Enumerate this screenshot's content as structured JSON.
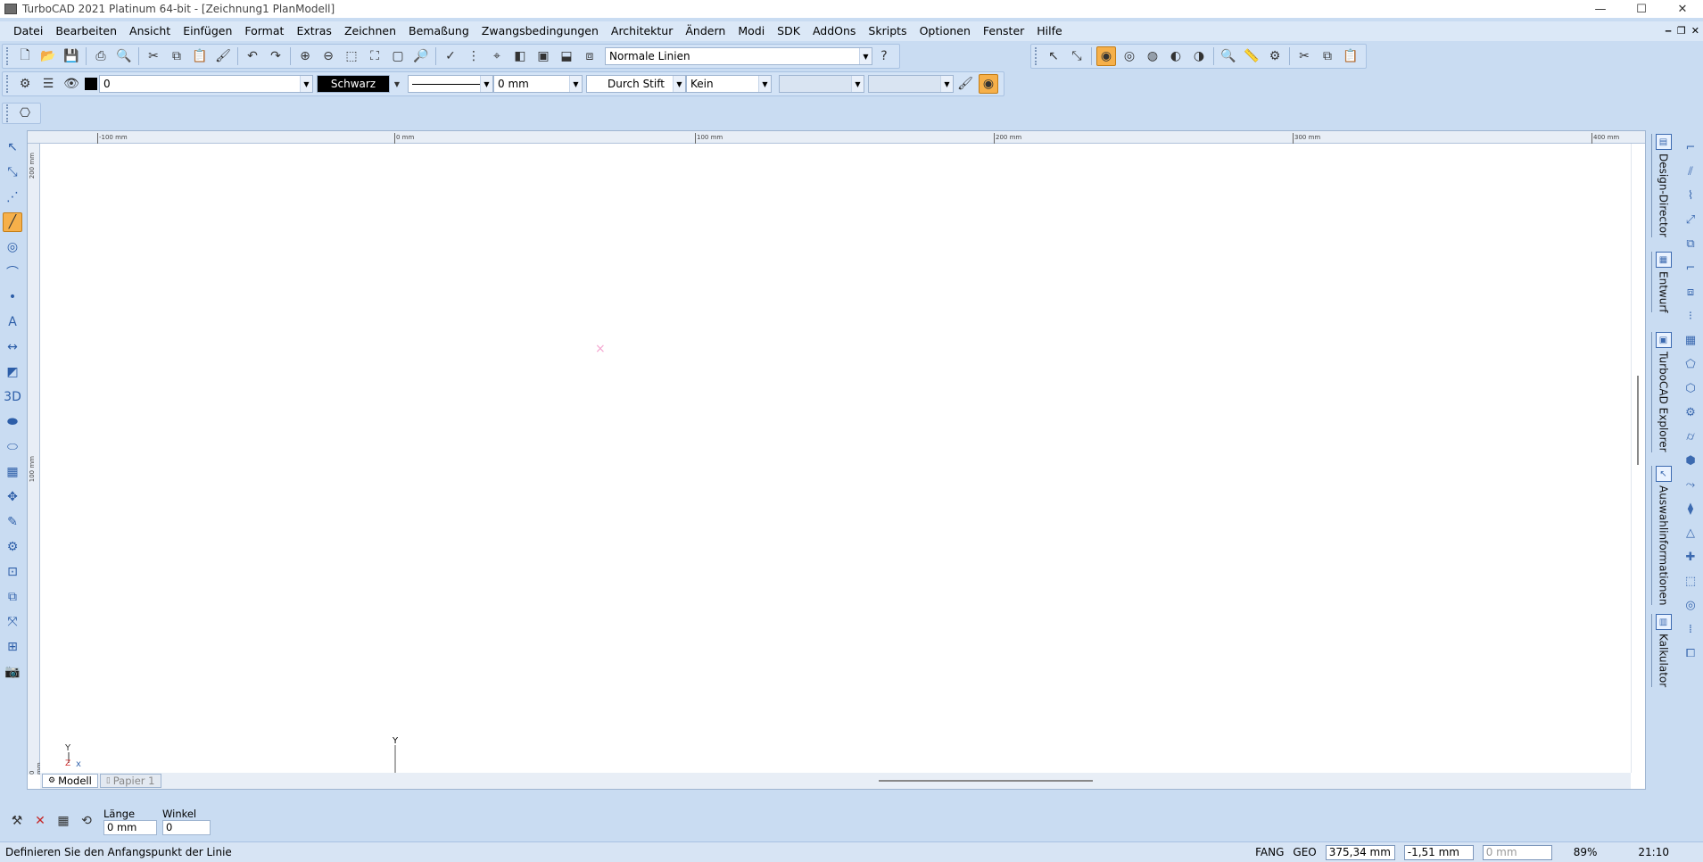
{
  "window": {
    "title": "TurboCAD 2021 Platinum 64-bit - [Zeichnung1 PlanModell]",
    "minimize": "—",
    "maximize": "☐",
    "close": "✕"
  },
  "menu": [
    "Datei",
    "Bearbeiten",
    "Ansicht",
    "Einfügen",
    "Format",
    "Extras",
    "Zeichnen",
    "Bemaßung",
    "Zwangsbedingungen",
    "Architektur",
    "Ändern",
    "Modi",
    "SDK",
    "AddOns",
    "Skripts",
    "Optionen",
    "Fenster",
    "Hilfe"
  ],
  "toolbar": {
    "line_style_combo": "Normale Linien"
  },
  "property_bar": {
    "layer": "0",
    "color": "Schwarz",
    "line_width": "0 mm",
    "pen": "Durch Stift",
    "fill": "Kein"
  },
  "rulers": {
    "horizontal": [
      "-100 mm",
      "0 mm",
      "100 mm",
      "200 mm",
      "300 mm",
      "400 mm"
    ],
    "vertical": [
      "200 mm",
      "100 mm",
      "0 mm"
    ]
  },
  "canvas": {
    "axis_x_label": "X",
    "axis_y_label": "Y"
  },
  "tabs": [
    "Modell",
    "Papier 1"
  ],
  "palettes": [
    "Design-Director",
    "Entwurf",
    "TurboCAD Explorer",
    "Auswahlinformationen",
    "Kalkulator"
  ],
  "inspector": {
    "length_label": "Länge",
    "length_value": "0 mm",
    "angle_label": "Winkel",
    "angle_value": "0"
  },
  "status": {
    "message": "Definieren Sie den Anfangspunkt der Linie",
    "fang": "FANG",
    "geo": "GEO",
    "x_coord": "375,34 mm",
    "y_coord": "-1,51 mm",
    "z_coord": "0 mm",
    "zoom": "89%",
    "time": "21:10"
  },
  "colors": {
    "accent": "#f6b04a",
    "background": "#c9dcf2"
  }
}
